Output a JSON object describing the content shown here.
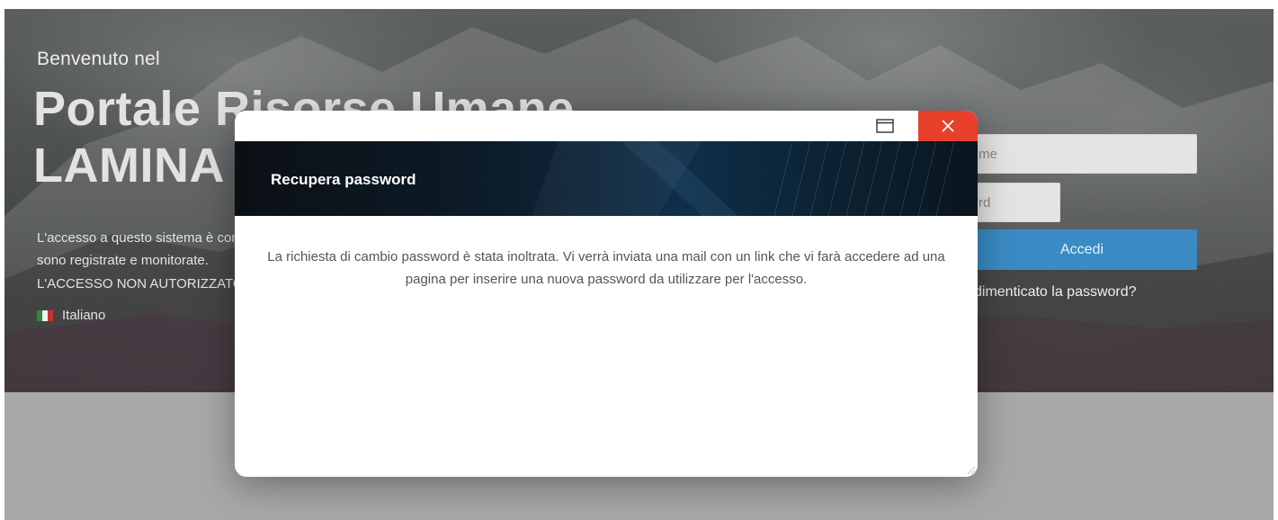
{
  "hero": {
    "welcome": "Benvenuto nel",
    "title_line1": "Portale Risorse Umane",
    "title_line2": "LAMINA",
    "notice_line1": "L'accesso a questo sistema è con",
    "notice_line2": "sono registrate e monitorate.",
    "notice_line3": "L'ACCESSO NON AUTORIZZATO",
    "language": "Italiano"
  },
  "login": {
    "username_placeholder": "me",
    "password_placeholder": "rd",
    "submit_label": "Accedi",
    "forgot_label": "i dimenticato la password?",
    "accent": "#3a8bc3"
  },
  "modal": {
    "title": "Recupera password",
    "message": "La richiesta di cambio password è stata inoltrata. Vi verrà inviata una mail con un link che vi farà accedere ad una pagina per inserire una nuova password da utilizzare per l'accesso.",
    "close_color": "#e8402a"
  },
  "icons": {
    "maximize": "maximize-icon",
    "close": "close-icon",
    "flag": "italian-flag-icon",
    "resize": "resize-grip-icon"
  }
}
